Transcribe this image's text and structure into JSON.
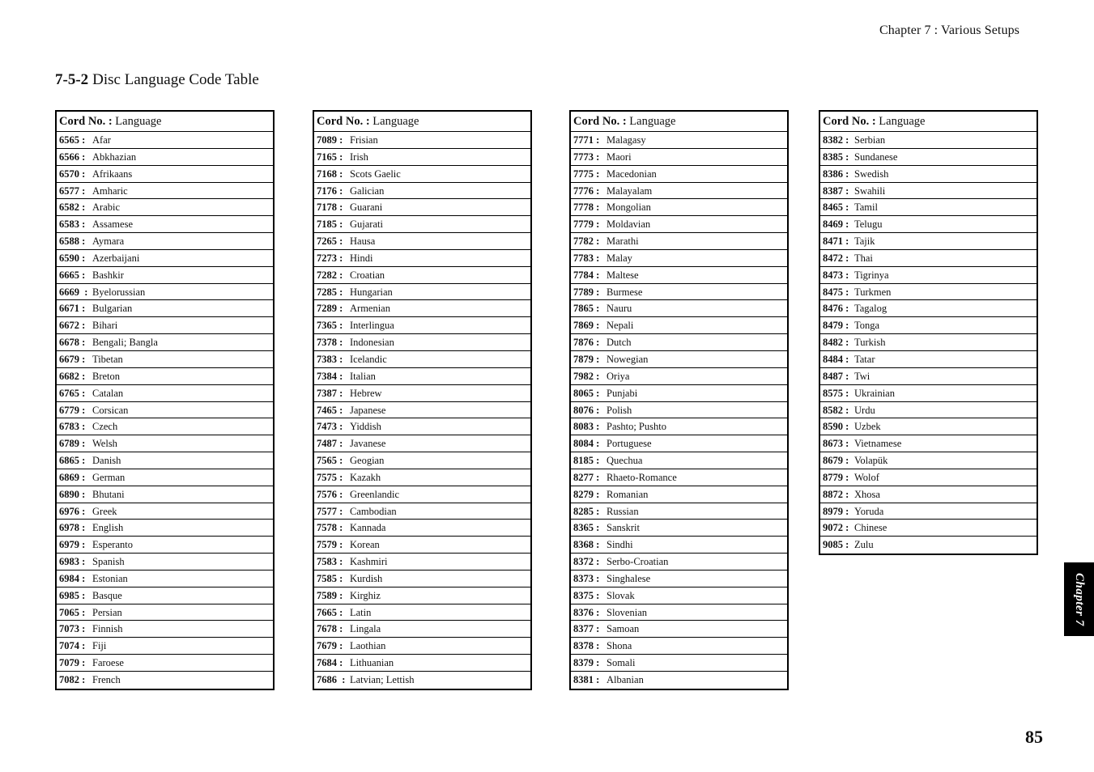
{
  "header": {
    "running_head": "Chapter 7 : Various Setups"
  },
  "section": {
    "number": "7-5-2",
    "title": "Disc Language Code Table"
  },
  "table_header": {
    "code_label": "Cord No. :",
    "language_label": "Language"
  },
  "tables": [
    {
      "rows": [
        {
          "code": "6565 :",
          "language": "Afar"
        },
        {
          "code": "6566 :",
          "language": "Abkhazian"
        },
        {
          "code": "6570 :",
          "language": "Afrikaans"
        },
        {
          "code": "6577 :",
          "language": "Amharic"
        },
        {
          "code": "6582 :",
          "language": "Arabic"
        },
        {
          "code": "6583 :",
          "language": "Assamese"
        },
        {
          "code": "6588 :",
          "language": "Aymara"
        },
        {
          "code": "6590 :",
          "language": "Azerbaijani"
        },
        {
          "code": "6665 :",
          "language": "Bashkir"
        },
        {
          "code": "6669  :",
          "language": "Byelorussian"
        },
        {
          "code": "6671 :",
          "language": "Bulgarian"
        },
        {
          "code": "6672 :",
          "language": "Bihari"
        },
        {
          "code": "6678 :",
          "language": "Bengali; Bangla"
        },
        {
          "code": "6679 :",
          "language": "Tibetan"
        },
        {
          "code": "6682 :",
          "language": "Breton"
        },
        {
          "code": "6765 :",
          "language": "Catalan"
        },
        {
          "code": "6779 :",
          "language": "Corsican"
        },
        {
          "code": "6783 :",
          "language": "Czech"
        },
        {
          "code": "6789 :",
          "language": "Welsh"
        },
        {
          "code": "6865 :",
          "language": "Danish"
        },
        {
          "code": "6869 :",
          "language": "German"
        },
        {
          "code": "6890 :",
          "language": "Bhutani"
        },
        {
          "code": "6976 :",
          "language": "Greek"
        },
        {
          "code": "6978 :",
          "language": "English"
        },
        {
          "code": "6979 :",
          "language": "Esperanto"
        },
        {
          "code": "6983 :",
          "language": "Spanish"
        },
        {
          "code": "6984 :",
          "language": "Estonian"
        },
        {
          "code": "6985 :",
          "language": "Basque"
        },
        {
          "code": "7065 :",
          "language": "Persian"
        },
        {
          "code": "7073 :",
          "language": "Finnish"
        },
        {
          "code": "7074 :",
          "language": "Fiji"
        },
        {
          "code": "7079 :",
          "language": "Faroese"
        },
        {
          "code": "7082 :",
          "language": "French"
        }
      ]
    },
    {
      "rows": [
        {
          "code": "7089 :",
          "language": "Frisian"
        },
        {
          "code": "7165 :",
          "language": "Irish"
        },
        {
          "code": "7168 :",
          "language": "Scots Gaelic"
        },
        {
          "code": "7176 :",
          "language": "Galician"
        },
        {
          "code": "7178 :",
          "language": "Guarani"
        },
        {
          "code": "7185 :",
          "language": "Gujarati"
        },
        {
          "code": "7265 :",
          "language": "Hausa"
        },
        {
          "code": "7273 :",
          "language": "Hindi"
        },
        {
          "code": "7282 :",
          "language": "Croatian"
        },
        {
          "code": "7285 :",
          "language": "Hungarian"
        },
        {
          "code": "7289 :",
          "language": "Armenian"
        },
        {
          "code": "7365 :",
          "language": "Interlingua"
        },
        {
          "code": "7378 :",
          "language": "Indonesian"
        },
        {
          "code": "7383 :",
          "language": "Icelandic"
        },
        {
          "code": "7384 :",
          "language": "Italian"
        },
        {
          "code": "7387 :",
          "language": "Hebrew"
        },
        {
          "code": "7465 :",
          "language": "Japanese"
        },
        {
          "code": "7473 :",
          "language": "Yiddish"
        },
        {
          "code": "7487 :",
          "language": "Javanese"
        },
        {
          "code": "7565 :",
          "language": "Geogian"
        },
        {
          "code": "7575 :",
          "language": "Kazakh"
        },
        {
          "code": "7576 :",
          "language": "Greenlandic"
        },
        {
          "code": "7577 :",
          "language": "Cambodian"
        },
        {
          "code": "7578 :",
          "language": "Kannada"
        },
        {
          "code": "7579 :",
          "language": "Korean"
        },
        {
          "code": "7583 :",
          "language": "Kashmiri"
        },
        {
          "code": "7585 :",
          "language": "Kurdish"
        },
        {
          "code": "7589 :",
          "language": "Kirghiz"
        },
        {
          "code": "7665 :",
          "language": "Latin"
        },
        {
          "code": "7678 :",
          "language": "Lingala"
        },
        {
          "code": "7679 :",
          "language": "Laothian"
        },
        {
          "code": "7684 :",
          "language": "Lithuanian"
        },
        {
          "code": "7686  :",
          "language": "Latvian; Lettish"
        }
      ]
    },
    {
      "rows": [
        {
          "code": "7771 :",
          "language": "Malagasy"
        },
        {
          "code": "7773 :",
          "language": "Maori"
        },
        {
          "code": "7775 :",
          "language": "Macedonian"
        },
        {
          "code": "7776 :",
          "language": "Malayalam"
        },
        {
          "code": "7778 :",
          "language": "Mongolian"
        },
        {
          "code": "7779 :",
          "language": "Moldavian"
        },
        {
          "code": "7782 :",
          "language": "Marathi"
        },
        {
          "code": "7783 :",
          "language": "Malay"
        },
        {
          "code": "7784 :",
          "language": "Maltese"
        },
        {
          "code": "7789 :",
          "language": "Burmese"
        },
        {
          "code": "7865 :",
          "language": "Nauru"
        },
        {
          "code": "7869 :",
          "language": "Nepali"
        },
        {
          "code": "7876 :",
          "language": "Dutch"
        },
        {
          "code": "7879 :",
          "language": "Nowegian"
        },
        {
          "code": "7982 :",
          "language": "Oriya"
        },
        {
          "code": "8065 :",
          "language": "Punjabi"
        },
        {
          "code": "8076 :",
          "language": "Polish"
        },
        {
          "code": "8083 :",
          "language": "Pashto; Pushto"
        },
        {
          "code": "8084 :",
          "language": "Portuguese"
        },
        {
          "code": "8185 :",
          "language": "Quechua"
        },
        {
          "code": "8277 :",
          "language": "Rhaeto-Romance"
        },
        {
          "code": "8279 :",
          "language": "Romanian"
        },
        {
          "code": "8285 :",
          "language": "Russian"
        },
        {
          "code": "8365 :",
          "language": "Sanskrit"
        },
        {
          "code": "8368 :",
          "language": "Sindhi"
        },
        {
          "code": "8372 :",
          "language": "Serbo-Croatian"
        },
        {
          "code": "8373 :",
          "language": "Singhalese"
        },
        {
          "code": "8375 :",
          "language": "Slovak"
        },
        {
          "code": "8376 :",
          "language": "Slovenian"
        },
        {
          "code": "8377 :",
          "language": "Samoan"
        },
        {
          "code": "8378 :",
          "language": "Shona"
        },
        {
          "code": "8379 :",
          "language": "Somali"
        },
        {
          "code": "8381 :",
          "language": "Albanian"
        }
      ]
    },
    {
      "rows": [
        {
          "code": "8382 :",
          "language": "Serbian"
        },
        {
          "code": "8385 :",
          "language": "Sundanese"
        },
        {
          "code": "8386 :",
          "language": "Swedish"
        },
        {
          "code": "8387 :",
          "language": "Swahili"
        },
        {
          "code": "8465 :",
          "language": "Tamil"
        },
        {
          "code": "8469 :",
          "language": "Telugu"
        },
        {
          "code": "8471 :",
          "language": "Tajik"
        },
        {
          "code": "8472 :",
          "language": "Thai"
        },
        {
          "code": "8473 :",
          "language": "Tigrinya"
        },
        {
          "code": "8475 :",
          "language": "Turkmen"
        },
        {
          "code": "8476 :",
          "language": "Tagalog"
        },
        {
          "code": "8479 :",
          "language": "Tonga"
        },
        {
          "code": "8482 :",
          "language": "Turkish"
        },
        {
          "code": "8484 :",
          "language": "Tatar"
        },
        {
          "code": "8487 :",
          "language": "Twi"
        },
        {
          "code": "8575 :",
          "language": "Ukrainian"
        },
        {
          "code": "8582 :",
          "language": "Urdu"
        },
        {
          "code": "8590 :",
          "language": "Uzbek"
        },
        {
          "code": "8673 :",
          "language": "Vietnamese"
        },
        {
          "code": "8679 :",
          "language": "Volapük"
        },
        {
          "code": "8779 :",
          "language": "Wolof"
        },
        {
          "code": "8872 :",
          "language": "Xhosa"
        },
        {
          "code": "8979 :",
          "language": "Yoruda"
        },
        {
          "code": "9072 :",
          "language": "Chinese"
        },
        {
          "code": "9085 :",
          "language": "Zulu"
        }
      ]
    }
  ],
  "chapter_tab": {
    "label": "Chapter 7"
  },
  "footer": {
    "page_number": "85"
  }
}
